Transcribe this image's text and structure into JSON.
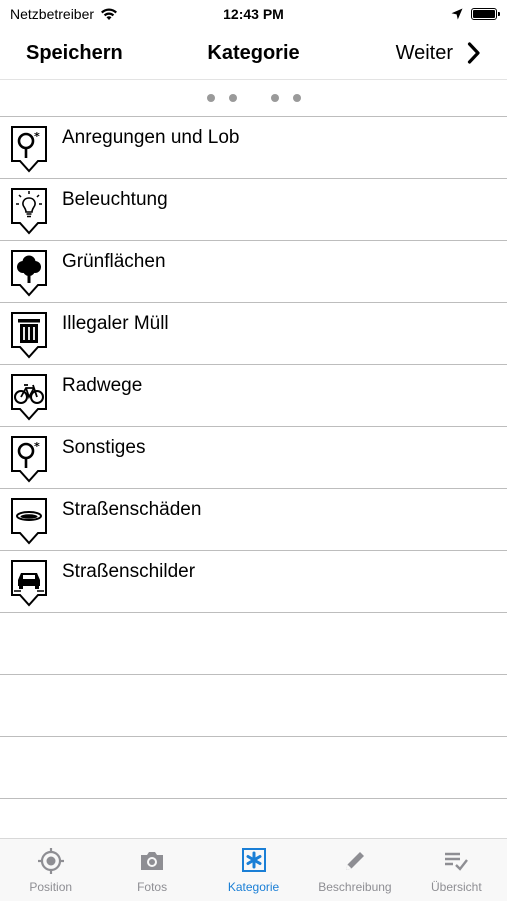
{
  "status": {
    "carrier": "Netzbetreiber",
    "time": "12:43 PM"
  },
  "nav": {
    "left_label": "Speichern",
    "title": "Kategorie",
    "right_label": "Weiter"
  },
  "categories": [
    {
      "label": "Anregungen und Lob",
      "icon": "key-asterisk-icon"
    },
    {
      "label": "Beleuchtung",
      "icon": "lightbulb-icon"
    },
    {
      "label": "Grünflächen",
      "icon": "tree-icon"
    },
    {
      "label": "Illegaler Müll",
      "icon": "trash-can-icon"
    },
    {
      "label": "Radwege",
      "icon": "bicycle-icon"
    },
    {
      "label": "Sonstiges",
      "icon": "key-asterisk-icon"
    },
    {
      "label": "Straßenschäden",
      "icon": "pothole-icon"
    },
    {
      "label": "Straßenschilder",
      "icon": "car-icon"
    }
  ],
  "tabs": [
    {
      "label": "Position",
      "icon": "crosshair-icon",
      "active": false
    },
    {
      "label": "Fotos",
      "icon": "camera-icon",
      "active": false
    },
    {
      "label": "Kategorie",
      "icon": "asterisk-icon",
      "active": true
    },
    {
      "label": "Beschreibung",
      "icon": "pencil-icon",
      "active": false
    },
    {
      "label": "Übersicht",
      "icon": "checklist-icon",
      "active": false
    }
  ],
  "colors": {
    "accent": "#1a7fd6",
    "tab_inactive": "#8e8e93",
    "separator": "#bdbdbd"
  }
}
